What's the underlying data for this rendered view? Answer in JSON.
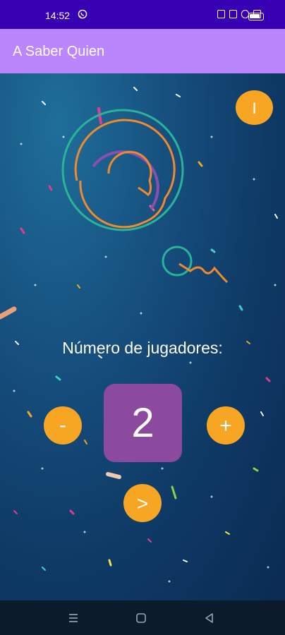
{
  "status_bar": {
    "time": "14:52",
    "battery_level": 0.85
  },
  "app_bar": {
    "title": "A Saber Quien"
  },
  "main": {
    "info_button_label": "I",
    "players_label": "Número de jugadores:",
    "player_count": "2",
    "minus_label": "-",
    "plus_label": "+",
    "next_label": ">"
  },
  "colors": {
    "status_bar": "#3700b3",
    "app_bar": "#bb86fc",
    "button_orange": "#f6a623",
    "count_box": "#8c4a9e",
    "logo_teal": "#2bb39a",
    "logo_orange": "#f08a2c",
    "logo_purple": "#8b4fb3"
  },
  "icons": {
    "status_messenger": "whatsapp-icon",
    "nav_recent": "menu-icon",
    "nav_home": "home-square-icon",
    "nav_back": "back-triangle-icon"
  }
}
